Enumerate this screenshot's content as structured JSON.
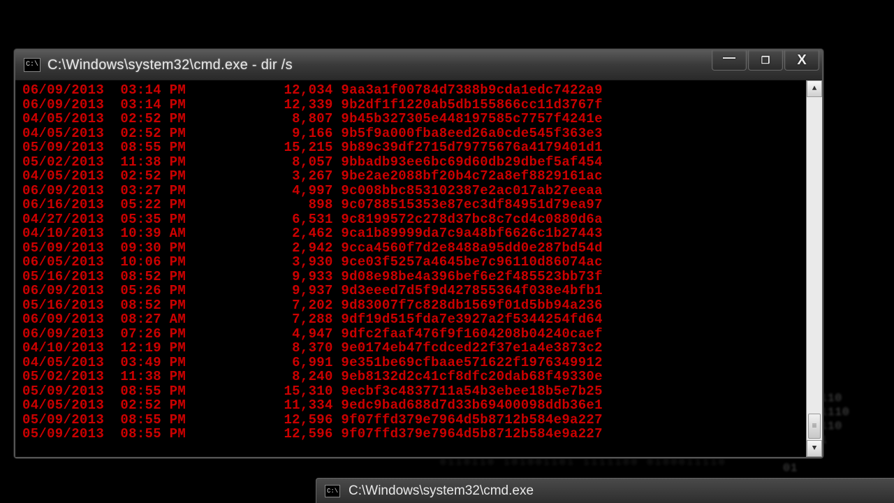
{
  "window": {
    "title": "C:\\Windows\\system32\\cmd.exe - dir /s",
    "sysicon_text": "C:\\",
    "buttons": {
      "min": "—",
      "max": "❐",
      "close": "X"
    }
  },
  "taskbar": {
    "label": "C:\\Windows\\system32\\cmd.exe",
    "sysicon_text": "C:\\"
  },
  "text_color": "#cc0000",
  "bg_color": "#000000",
  "rows": [
    {
      "date": "06/09/2013",
      "time": "03:14 PM",
      "size": "12,034",
      "name": "9aa3a1f00784d7388b9cda1edc7422a9"
    },
    {
      "date": "06/09/2013",
      "time": "03:14 PM",
      "size": "12,339",
      "name": "9b2df1f1220ab5db155866cc11d3767f"
    },
    {
      "date": "04/05/2013",
      "time": "02:52 PM",
      "size": "8,807",
      "name": "9b45b327305e448197585c7757f4241e"
    },
    {
      "date": "04/05/2013",
      "time": "02:52 PM",
      "size": "9,166",
      "name": "9b5f9a000fba8eed26a0cde545f363e3"
    },
    {
      "date": "05/09/2013",
      "time": "08:55 PM",
      "size": "15,215",
      "name": "9b89c39df2715d79775676a4179401d1"
    },
    {
      "date": "05/02/2013",
      "time": "11:38 PM",
      "size": "8,057",
      "name": "9bbadb93ee6bc69d60db29dbef5af454"
    },
    {
      "date": "04/05/2013",
      "time": "02:52 PM",
      "size": "3,267",
      "name": "9be2ae2088bf20b4c72a8ef8829161ac"
    },
    {
      "date": "06/09/2013",
      "time": "03:27 PM",
      "size": "4,997",
      "name": "9c008bbc853102387e2ac017ab27eeaa"
    },
    {
      "date": "06/16/2013",
      "time": "05:22 PM",
      "size": "898",
      "name": "9c0788515353e87ec3df84951d79ea97"
    },
    {
      "date": "04/27/2013",
      "time": "05:35 PM",
      "size": "6,531",
      "name": "9c8199572c278d37bc8c7cd4c0880d6a"
    },
    {
      "date": "04/10/2013",
      "time": "10:39 AM",
      "size": "2,462",
      "name": "9ca1b89999da7c9a48bf6626c1b27443"
    },
    {
      "date": "05/09/2013",
      "time": "09:30 PM",
      "size": "2,942",
      "name": "9cca4560f7d2e8488a95dd0e287bd54d"
    },
    {
      "date": "06/05/2013",
      "time": "10:06 PM",
      "size": "3,930",
      "name": "9ce03f5257a4645be7c96110d86074ac"
    },
    {
      "date": "05/16/2013",
      "time": "08:52 PM",
      "size": "9,933",
      "name": "9d08e98be4a396bef6e2f485523bb73f"
    },
    {
      "date": "06/09/2013",
      "time": "05:26 PM",
      "size": "9,937",
      "name": "9d3eeed7d5f9d427855364f038e4bfb1"
    },
    {
      "date": "05/16/2013",
      "time": "08:52 PM",
      "size": "7,202",
      "name": "9d83007f7c828db1569f01d5bb94a236"
    },
    {
      "date": "06/09/2013",
      "time": "08:27 AM",
      "size": "7,288",
      "name": "9df19d515fda7e3927a2f5344254fd64"
    },
    {
      "date": "06/09/2013",
      "time": "07:26 PM",
      "size": "4,947",
      "name": "9dfc2faaf476f9f1604208b04240caef"
    },
    {
      "date": "04/10/2013",
      "time": "12:19 PM",
      "size": "8,370",
      "name": "9e0174eb47fcdced22f37e1a4e3873c2"
    },
    {
      "date": "04/05/2013",
      "time": "03:49 PM",
      "size": "6,991",
      "name": "9e351be69cfbaae571622f1976349912"
    },
    {
      "date": "05/02/2013",
      "time": "11:38 PM",
      "size": "8,240",
      "name": "9eb8132d2c41cf8dfc20dab68f49330e"
    },
    {
      "date": "05/09/2013",
      "time": "08:55 PM",
      "size": "15,310",
      "name": "9ecbf3c4837711a54b3ebee18b5e7b25"
    },
    {
      "date": "04/05/2013",
      "time": "02:52 PM",
      "size": "11,334",
      "name": "9edc9bad688d7d33b69400098ddb36e1"
    },
    {
      "date": "05/09/2013",
      "time": "08:55 PM",
      "size": "12,596",
      "name": "9f07ffd379e7964d5b8712b584e9a227"
    },
    {
      "date": "05/09/2013",
      "time": "08:55 PM",
      "size": "12,596",
      "name": "9f07ffd379e7964d5b8712b584e9a227"
    }
  ],
  "scrollbar": {
    "up": "▲",
    "down": "▼"
  },
  "bg_noise_right": "  .110\n 010011110\n  011001110\n0110100110\n  010111\n01101\n  01",
  "bg_noise_bottom": "0110110    101001101 1111100    0100011110"
}
